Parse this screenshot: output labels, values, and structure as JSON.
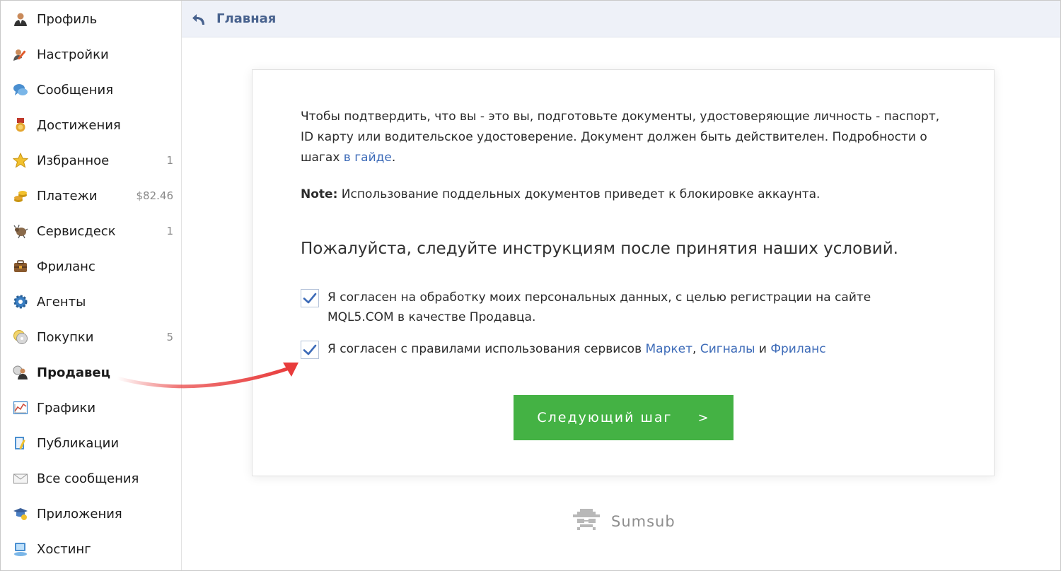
{
  "sidebar": {
    "items": [
      {
        "label": "Профиль",
        "icon": "user-icon",
        "count": ""
      },
      {
        "label": "Настройки",
        "icon": "settings-icon",
        "count": ""
      },
      {
        "label": "Сообщения",
        "icon": "messages-icon",
        "count": ""
      },
      {
        "label": "Достижения",
        "icon": "medal-icon",
        "count": ""
      },
      {
        "label": "Избранное",
        "icon": "star-icon",
        "count": "1"
      },
      {
        "label": "Платежи",
        "icon": "coins-icon",
        "count": "$82.46"
      },
      {
        "label": "Сервисдеск",
        "icon": "bug-icon",
        "count": "1"
      },
      {
        "label": "Фриланс",
        "icon": "briefcase-icon",
        "count": ""
      },
      {
        "label": "Агенты",
        "icon": "gear-icon",
        "count": ""
      },
      {
        "label": "Покупки",
        "icon": "disc-icon",
        "count": "5"
      },
      {
        "label": "Продавец",
        "icon": "seller-icon",
        "count": ""
      },
      {
        "label": "Графики",
        "icon": "chart-icon",
        "count": ""
      },
      {
        "label": "Публикации",
        "icon": "publication-icon",
        "count": ""
      },
      {
        "label": "Все сообщения",
        "icon": "envelope-icon",
        "count": ""
      },
      {
        "label": "Приложения",
        "icon": "apps-icon",
        "count": ""
      },
      {
        "label": "Хостинг",
        "icon": "hosting-icon",
        "count": ""
      }
    ],
    "active_index": 10
  },
  "header": {
    "breadcrumb": "Главная"
  },
  "card": {
    "intro_text": "Чтобы подтвердить, что вы - это вы, подготовьте документы, удостоверяющие личность - паспорт, ID карту или водительское удостоверение. Документ должен быть действителен. Подробности о шагах ",
    "guide_link": "в гайде",
    "intro_end": ".",
    "note_label": "Note:",
    "note_text": " Использование поддельных документов приведет к блокировке аккаунта.",
    "subheading": "Пожалуйста, следуйте инструкциям после принятия наших условий.",
    "consent_1": "Я согласен на обработку моих персональных данных, с целью регистрации на сайте MQL5.COM в качестве Продавца.",
    "consent_2_prefix": "Я согласен с правилами использования сервисов ",
    "consent_2_link_market": "Маркет",
    "consent_2_sep": ", ",
    "consent_2_link_signals": "Сигналы",
    "consent_2_and": " и ",
    "consent_2_link_freelance": "Фриланс",
    "next_button": "Следующий шаг",
    "next_chevron": ">"
  },
  "footer": {
    "brand": "Sumsub"
  },
  "colors": {
    "accent_green": "#44b244",
    "link_blue": "#3d6bb8",
    "header_bg": "#eef1f8",
    "arrow_red": "#e83b3b"
  }
}
